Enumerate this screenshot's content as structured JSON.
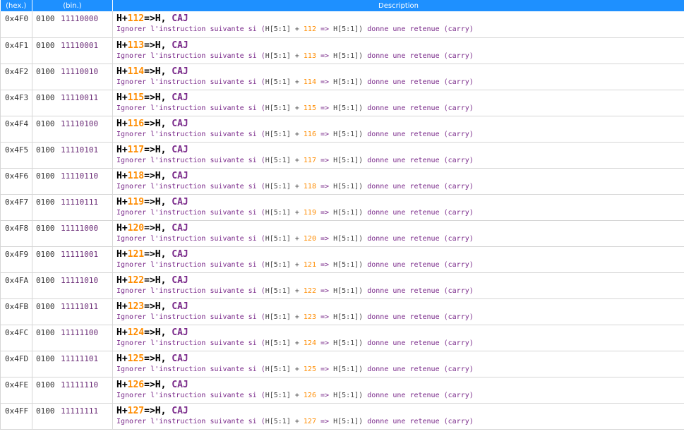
{
  "header": {
    "hex": "(hex.)",
    "bin": "(bin.)",
    "description": "Description"
  },
  "colors": {
    "header_bg": "#1e90ff",
    "immediate": "#ff8c00",
    "flag": "#7a2a8a",
    "description_text": "#7a2a8a"
  },
  "template": {
    "mn_prefix": "H+",
    "mn_suffix": "=>H, ",
    "flag": "CAJ",
    "desc_prefix": "Ignorer l'instruction suivante si (",
    "desc_reg": "H[5:1] + ",
    "desc_arrow": " => ",
    "desc_result": "H[5:1])",
    "desc_suffix": " donne une retenue (carry)"
  },
  "rows": [
    {
      "hex": "0x4F0",
      "bin_hi": "0100",
      "bin_lo": "11110000",
      "imm": "112"
    },
    {
      "hex": "0x4F1",
      "bin_hi": "0100",
      "bin_lo": "11110001",
      "imm": "113"
    },
    {
      "hex": "0x4F2",
      "bin_hi": "0100",
      "bin_lo": "11110010",
      "imm": "114"
    },
    {
      "hex": "0x4F3",
      "bin_hi": "0100",
      "bin_lo": "11110011",
      "imm": "115"
    },
    {
      "hex": "0x4F4",
      "bin_hi": "0100",
      "bin_lo": "11110100",
      "imm": "116"
    },
    {
      "hex": "0x4F5",
      "bin_hi": "0100",
      "bin_lo": "11110101",
      "imm": "117"
    },
    {
      "hex": "0x4F6",
      "bin_hi": "0100",
      "bin_lo": "11110110",
      "imm": "118"
    },
    {
      "hex": "0x4F7",
      "bin_hi": "0100",
      "bin_lo": "11110111",
      "imm": "119"
    },
    {
      "hex": "0x4F8",
      "bin_hi": "0100",
      "bin_lo": "11111000",
      "imm": "120"
    },
    {
      "hex": "0x4F9",
      "bin_hi": "0100",
      "bin_lo": "11111001",
      "imm": "121"
    },
    {
      "hex": "0x4FA",
      "bin_hi": "0100",
      "bin_lo": "11111010",
      "imm": "122"
    },
    {
      "hex": "0x4FB",
      "bin_hi": "0100",
      "bin_lo": "11111011",
      "imm": "123"
    },
    {
      "hex": "0x4FC",
      "bin_hi": "0100",
      "bin_lo": "11111100",
      "imm": "124"
    },
    {
      "hex": "0x4FD",
      "bin_hi": "0100",
      "bin_lo": "11111101",
      "imm": "125"
    },
    {
      "hex": "0x4FE",
      "bin_hi": "0100",
      "bin_lo": "11111110",
      "imm": "126"
    },
    {
      "hex": "0x4FF",
      "bin_hi": "0100",
      "bin_lo": "11111111",
      "imm": "127"
    }
  ]
}
